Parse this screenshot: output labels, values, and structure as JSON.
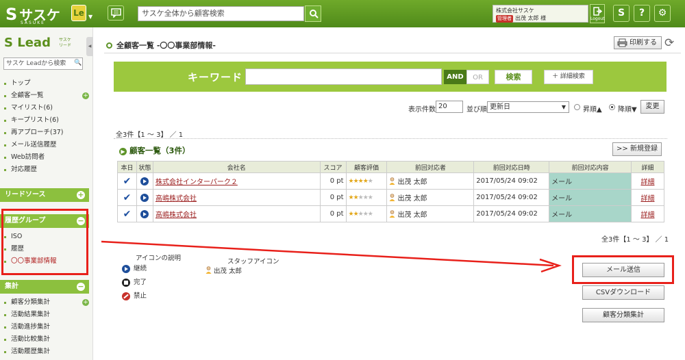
{
  "header": {
    "logo": "サスケ",
    "logo_sub": "SASUKE",
    "le_label": "Le",
    "le_caret": "▼",
    "search_placeholder": "サスケ全体から顧客検索",
    "company": "株式会社サスケ",
    "role_badge": "管理者",
    "user": "出茂 太郎 様",
    "logout": "Logout",
    "icon_s": "S",
    "icon_help": "?",
    "icon_settings": "⚙"
  },
  "sidebar": {
    "brand": "Lead",
    "brand_small": "サスケ リード",
    "collapse": "◀",
    "search_placeholder": "サスケ Leadから検索",
    "search_icon": "🔍",
    "nav": [
      "トップ",
      "全顧客一覧",
      "マイリスト(6)",
      "キープリスト(6)",
      "再アプローチ(37)",
      "メール送信履歴",
      "Web訪問者",
      "対応履歴"
    ],
    "lead_source": "リードソース",
    "history_group": "履歴グループ",
    "history_items": [
      "ISO",
      "履歴",
      "〇〇事業部情報"
    ],
    "aggregate": "集計",
    "aggregate_items": [
      "顧客分類集計",
      "活動結果集計",
      "活動進捗集計",
      "活動比較集計",
      "活動履歴集計"
    ],
    "plus": "+",
    "minus": "−"
  },
  "main": {
    "title": "全顧客一覧 -〇〇事業部情報-",
    "print": "印刷する",
    "refresh": "⟳",
    "keyword_label": "キーワード",
    "and": "AND",
    "or": "OR",
    "search": "検索",
    "detail_search": "＋ 詳細検索",
    "display_count_label": "表示件数",
    "display_count": "20",
    "order_label": "並び順",
    "order_value": "更新日",
    "asc": "昇順▲",
    "desc": "降順▼",
    "change": "変更",
    "count_text": "全3件【1 ～ 3】 ／ 1",
    "list_title": "顧客一覧（3件）",
    "new_register": ">> 新規登録",
    "columns": [
      "本日",
      "状態",
      "会社名",
      "スコア",
      "顧客評価",
      "前回対応者",
      "前回対応日時",
      "前回対応内容",
      "詳細"
    ],
    "rows": [
      {
        "company": "株式会社インターパーク２",
        "score": "0 pt",
        "stars_on": "★★★★",
        "stars_off": "★",
        "staff": "出茂 太郎",
        "date": "2017/05/24 09:02",
        "content": "メール",
        "detail": "詳細"
      },
      {
        "company": "高嶋株式会社",
        "score": "0 pt",
        "stars_on": "★★",
        "stars_off": "★★★",
        "staff": "出茂 太郎",
        "date": "2017/05/24 09:02",
        "content": "メール",
        "detail": "詳細"
      },
      {
        "company": "高嶋株式会社",
        "score": "0 pt",
        "stars_on": "★★",
        "stars_off": "★★★",
        "staff": "出茂 太郎",
        "date": "2017/05/24 09:02",
        "content": "メール",
        "detail": "詳細"
      }
    ],
    "check_mark": "✔",
    "count_text_bottom": "全3件【1 ～ 3】 ／ 1",
    "legend_title": "アイコンの説明",
    "legend_continue": "継続",
    "legend_done": "完了",
    "legend_ban": "禁止",
    "staff_legend_title": "スタッフアイコン",
    "staff_legend": "出茂 太郎",
    "mail_send": "メール送信",
    "csv_download": "CSVダウンロード",
    "category_aggregate": "顧客分類集計"
  }
}
